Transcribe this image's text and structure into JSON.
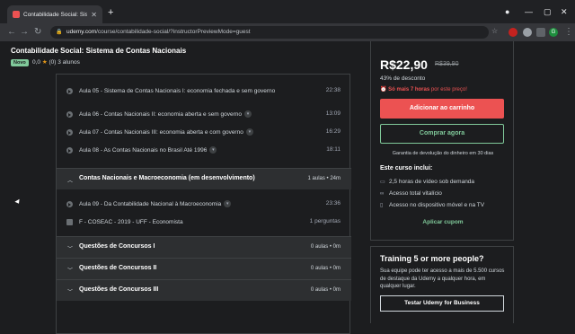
{
  "browser": {
    "tab_title": "Contabilidade Social: Sistema de",
    "url_domain": "udemy.com",
    "url_path": "/course/contabilidade-social/?instructorPreviewMode=guest",
    "profile_initial": "G"
  },
  "course": {
    "title": "Contabilidade Social: Sistema de Contas Nacionais",
    "badge": "Novo",
    "rating": "0,0",
    "reviews": "(0)",
    "students": "3 alunos"
  },
  "curriculum": {
    "lectures_top": [
      {
        "name": "Aula 05 - Sistema de Contas Nacionais I: economia fechada e sem governo",
        "duration": "22:38",
        "chevron": false
      },
      {
        "name": "Aula 06 - Contas Nacionais II: economia aberta e sem governo",
        "duration": "13:09",
        "chevron": true
      },
      {
        "name": "Aula 07 - Contas Nacionais III: economia aberta e com governo",
        "duration": "16:29",
        "chevron": true
      },
      {
        "name": "Aula 08 - As Contas Nacionais no Brasil Até 1996",
        "duration": "18:11",
        "chevron": true
      }
    ],
    "section_open": {
      "name": "Contas Nacionais e Macroeconomia (em desenvolvimento)",
      "info": "1 aulas • 24m"
    },
    "lectures_open": [
      {
        "name": "Aula 09 - Da Contabilidade Nacional à Macroeconomia",
        "duration": "23:36",
        "chevron": true
      },
      {
        "name": "F - COSEAC - 2019 - UFF - Economista",
        "duration": "1 perguntas",
        "chevron": false
      }
    ],
    "sections_closed": [
      {
        "name": "Questões de Concursos I",
        "info": "0 aulas • 0m"
      },
      {
        "name": "Questões de Concursos II",
        "info": "0 aulas • 0m"
      },
      {
        "name": "Questões de Concursos III",
        "info": "0 aulas • 0m"
      }
    ]
  },
  "sidebar": {
    "price": "R$22,90",
    "old_price": "R$39,90",
    "discount": "43% de desconto",
    "timer_bold": "Só mais 7 horas",
    "timer_rest": " por este preço!",
    "add_to_cart": "Adicionar ao carrinho",
    "buy_now": "Comprar agora",
    "guarantee": "Garantia de devolução do dinheiro em 30 dias",
    "includes_title": "Este curso inclui:",
    "includes": [
      "2,5 horas de vídeo sob demanda",
      "Acesso total vitalício",
      "Acesso no dispositivo móvel e na TV"
    ],
    "coupon": "Aplicar cupom"
  },
  "team": {
    "title": "Training 5 or more people?",
    "desc": "Sua equipe pode ter acesso a mais de 5.500 cursos de destaque da Udemy a qualquer hora, em qualquer lugar.",
    "button": "Testar Udemy for Business"
  },
  "colors": {
    "accent": "#ec5252",
    "green": "#80c99a",
    "background": "#1c1d1f"
  }
}
